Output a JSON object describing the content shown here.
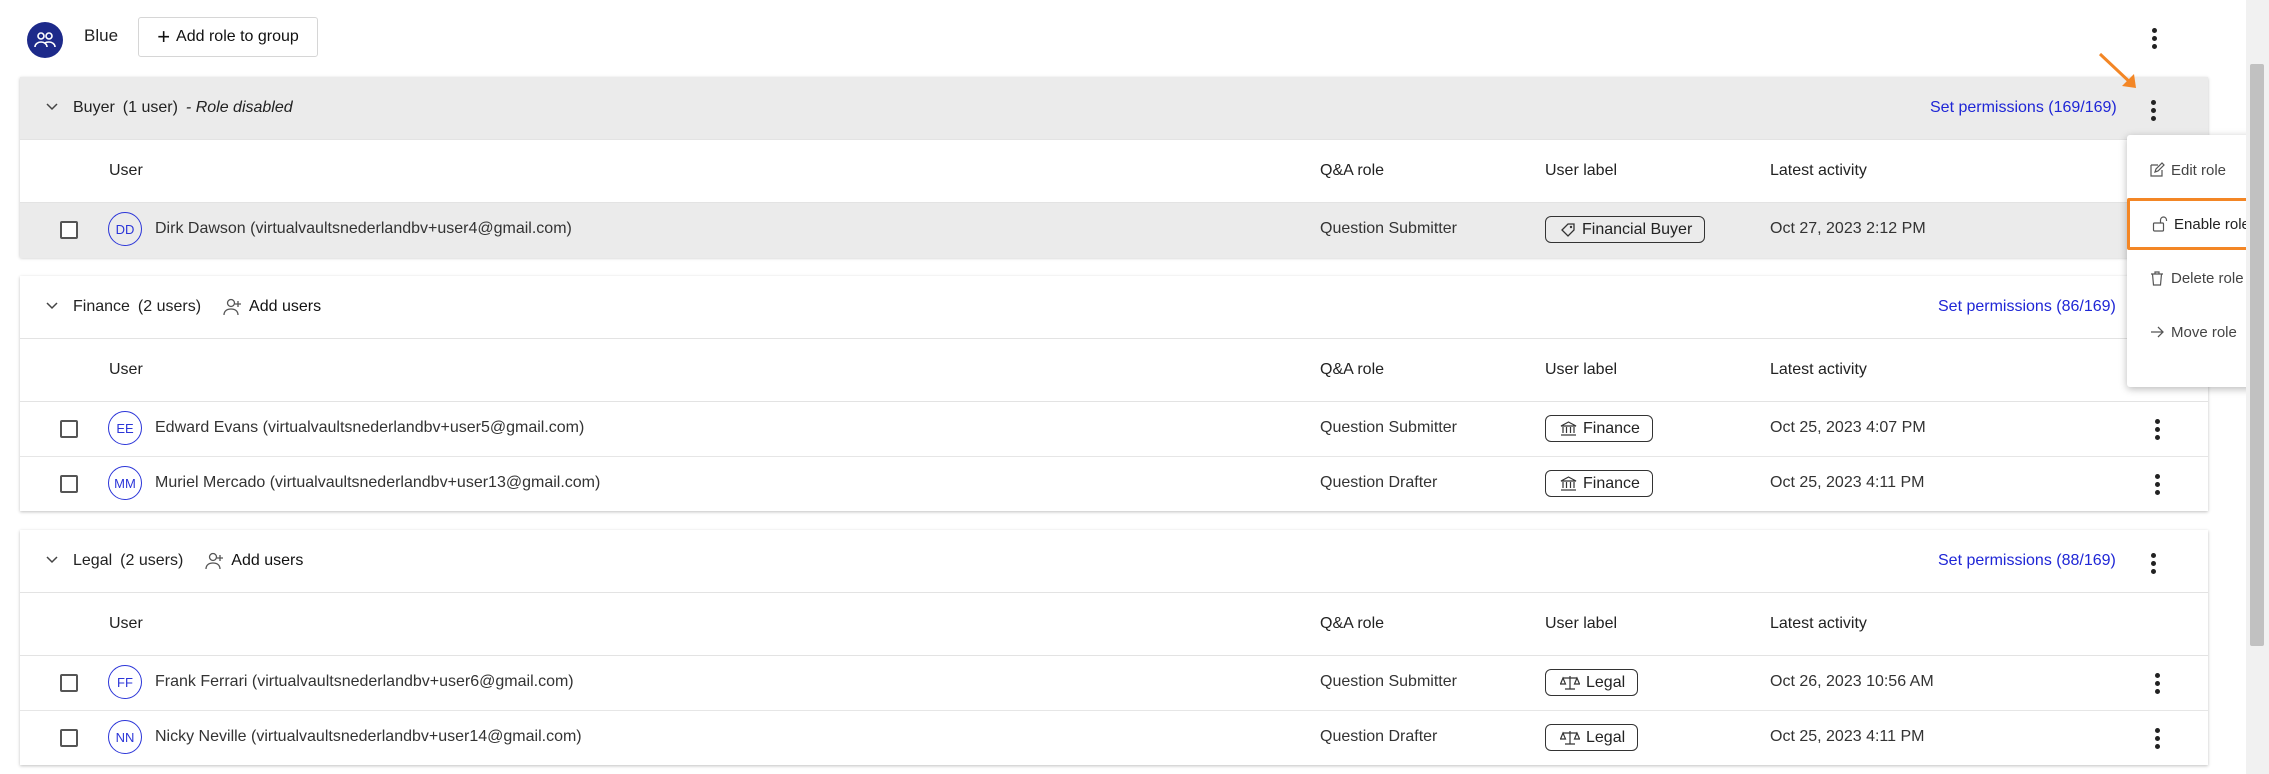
{
  "header": {
    "group_name": "Blue",
    "add_role_label": "Add role to group"
  },
  "columns": {
    "user": "User",
    "qa_role": "Q&A role",
    "user_label": "User label",
    "latest_activity": "Latest activity"
  },
  "sections": [
    {
      "title": "Buyer",
      "count": "(1 user)",
      "note": "- Role disabled",
      "set_permissions": "Set permissions  (169/169)",
      "rows": [
        {
          "initials": "DD",
          "name": "Dirk Dawson (virtualvaultsnederlandbv+user4@gmail.com)",
          "qa_role": "Question Submitter",
          "label": "Financial Buyer",
          "label_icon": "tag-icon",
          "activity": "Oct 27, 2023 2:12 PM"
        }
      ]
    },
    {
      "title": "Finance",
      "count": "(2 users)",
      "add_users": "Add users",
      "set_permissions": "Set permissions  (86/169)",
      "rows": [
        {
          "initials": "EE",
          "name": "Edward Evans (virtualvaultsnederlandbv+user5@gmail.com)",
          "qa_role": "Question Submitter",
          "label": "Finance",
          "label_icon": "bank-icon",
          "activity": "Oct 25, 2023 4:07 PM"
        },
        {
          "initials": "MM",
          "name": "Muriel Mercado (virtualvaultsnederlandbv+user13@gmail.com)",
          "qa_role": "Question Drafter",
          "label": "Finance",
          "label_icon": "bank-icon",
          "activity": "Oct 25, 2023 4:11 PM"
        }
      ]
    },
    {
      "title": "Legal",
      "count": "(2 users)",
      "add_users": "Add users",
      "set_permissions": "Set permissions  (88/169)",
      "rows": [
        {
          "initials": "FF",
          "name": "Frank Ferrari (virtualvaultsnederlandbv+user6@gmail.com)",
          "qa_role": "Question Submitter",
          "label": "Legal",
          "label_icon": "scales-icon",
          "activity": "Oct 26, 2023 10:56 AM"
        },
        {
          "initials": "NN",
          "name": "Nicky Neville (virtualvaultsnederlandbv+user14@gmail.com)",
          "qa_role": "Question Drafter",
          "label": "Legal",
          "label_icon": "scales-icon",
          "activity": "Oct 25, 2023 4:11 PM"
        }
      ]
    }
  ],
  "menu": {
    "edit_role": "Edit role",
    "enable_role": "Enable role",
    "delete_role": "Delete role",
    "move_role": "Move role"
  },
  "colors": {
    "accent_link": "#1f26d6",
    "highlight": "#f38625",
    "group_icon_bg": "#1d2a8a"
  }
}
